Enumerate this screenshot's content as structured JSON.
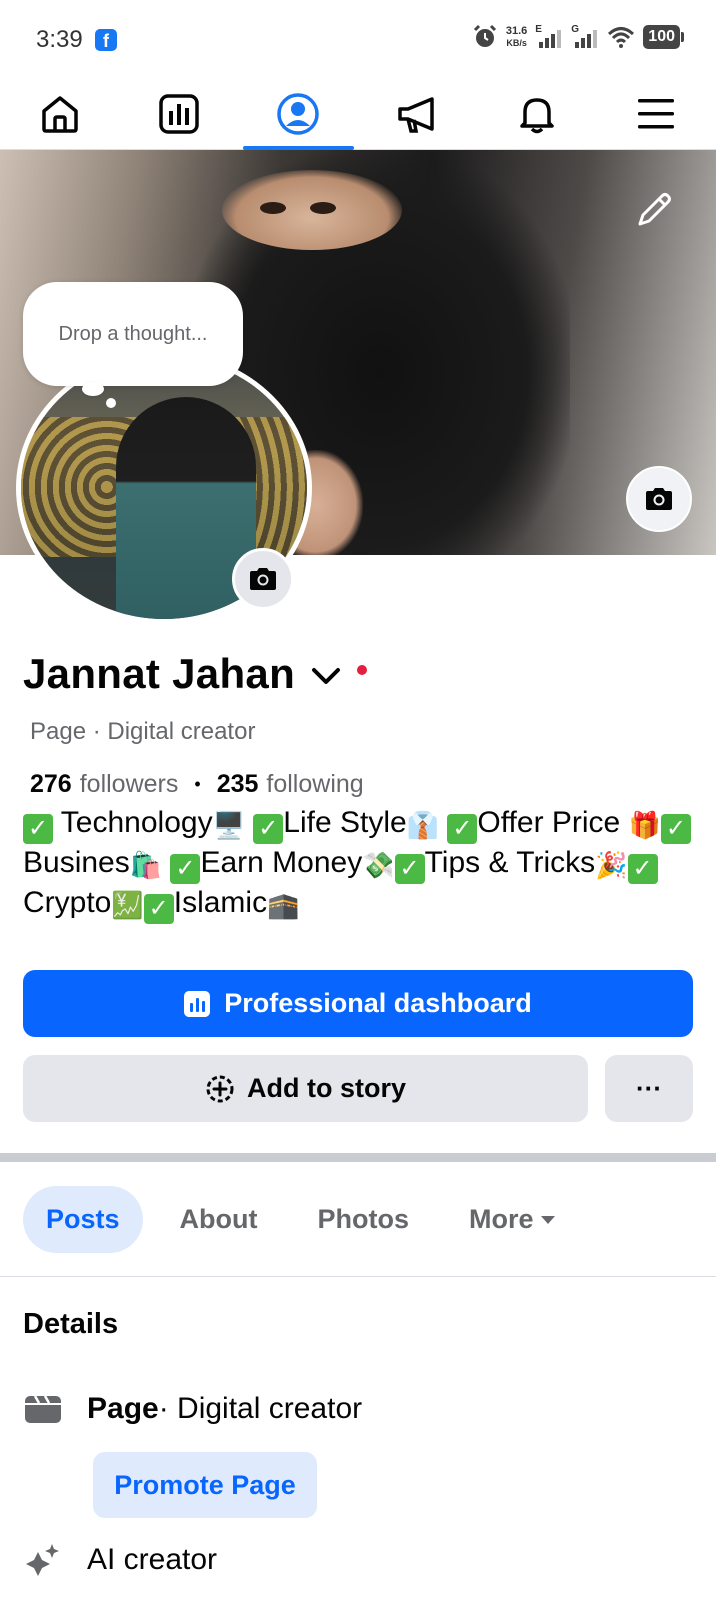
{
  "status_bar": {
    "time": "3:39",
    "fb_badge": "f",
    "speed_value": "31.6",
    "speed_unit": "KB/s",
    "net1": "E",
    "net2": "G",
    "battery": "100"
  },
  "top_nav": {
    "items": [
      {
        "icon": "home-icon"
      },
      {
        "icon": "dashboard-icon"
      },
      {
        "icon": "profile-icon",
        "active": true
      },
      {
        "icon": "megaphone-icon"
      },
      {
        "icon": "bell-icon"
      },
      {
        "icon": "menu-icon"
      }
    ],
    "active_color": "#1877f2"
  },
  "profile": {
    "thought_placeholder": "Drop a thought...",
    "name": "Jannat Jahan",
    "category": "Page · Digital creator",
    "followers_count": "276",
    "followers_label": "followers",
    "separator": "•",
    "following_count": "235",
    "following_label": "following",
    "bio": {
      "items": [
        {
          "text": " Technology",
          "emoji": "🖥️"
        },
        {
          "text": " ",
          "emoji": ""
        },
        {
          "text": "Life Style",
          "emoji": "👔"
        },
        {
          "text": " ",
          "emoji": ""
        },
        {
          "text": "Offer Price",
          "emoji": "🎁"
        }
      ],
      "segments": [
        "Technology",
        "Life Style",
        "Offer Price",
        "Busines",
        "Earn Money",
        "Tips & Tricks",
        "Crypto",
        "Islamic"
      ],
      "check": "✓"
    }
  },
  "buttons": {
    "professional_dashboard": "Professional dashboard",
    "add_to_story": "Add to story",
    "more": "···"
  },
  "tabs": [
    {
      "label": "Posts",
      "active": true
    },
    {
      "label": "About"
    },
    {
      "label": "Photos"
    },
    {
      "label": "More"
    }
  ],
  "details": {
    "title": "Details",
    "page_label": "Page",
    "page_category": " · Digital creator",
    "promote_label": "Promote Page",
    "ai_label": "AI creator"
  },
  "colors": {
    "brand_blue": "#0866ff",
    "tab_active_bg": "#dfebfd",
    "secondary_button": "#e4e6eb",
    "online_dot": "#e41e3f"
  }
}
